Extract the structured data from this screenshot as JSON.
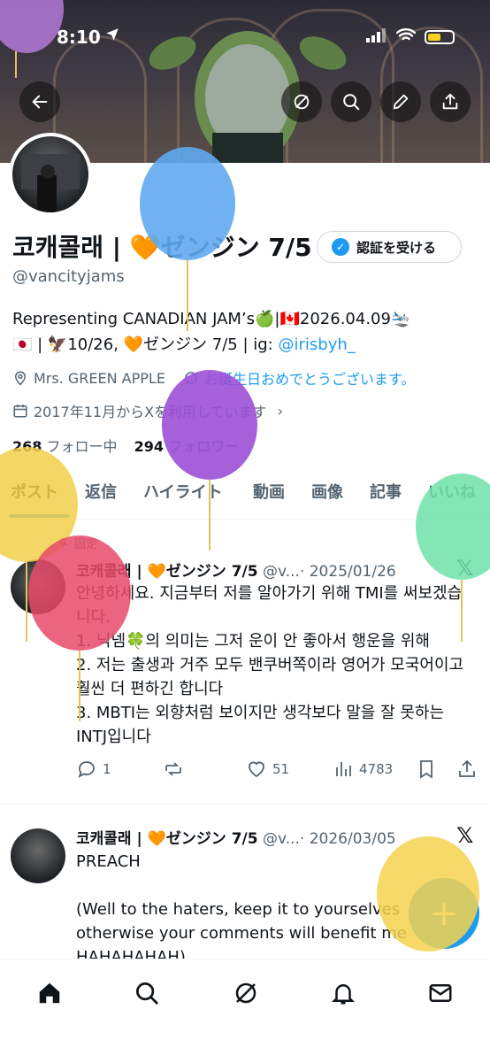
{
  "status_bar": {
    "time": "8:10"
  },
  "header_buttons": [
    "back-icon",
    "grok-icon",
    "search-icon",
    "edit-icon",
    "share-icon"
  ],
  "profile": {
    "display_name": "코캐콜래 | 🧡ゼンジン 7/5",
    "verify_button": "認証を受ける",
    "handle": "@vancityjams",
    "bio_line1": "Representing CANADIAN JAM’s🍏|🇨🇦2026.04.09🛬",
    "bio_line2_prefix": "🇯🇵 | 🦅10/26, 🧡ゼンジン 7/5 | ig: ",
    "bio_link": "@irisbyh_",
    "location": "Mrs. GREEN APPLE",
    "birthday": "お誕生日おめでとうございます。",
    "joined": "2017年11月からXを利用しています",
    "following_count": "268",
    "following_label": "フォロー中",
    "followers_count": "294",
    "followers_label": "フォロワー"
  },
  "tabs": [
    "ポスト",
    "返信",
    "ハイライト",
    "動画",
    "画像",
    "記事",
    "いいね"
  ],
  "posts": [
    {
      "pinned_label": "固定",
      "author": "코캐콜래 | 🧡ゼンジン 7/5",
      "handle": "@v...",
      "date": "· 2025/01/26",
      "text": "안녕하세요. 지금부터 저를 알아가기 위해 TMI를 써보겠습니다.\n1. 닉넴🍀의 의미는 그저 운이 안 좋아서 행운을 위해\n2. 저는 출생과 거주 모두 밴쿠버쪽이라 영어가 모국어이고 훨씬 더 편하긴 합니다\n3. MBTI는 외향처럼 보이지만 생각보다 말을 잘 못하는 INTJ입니다",
      "replies": "1",
      "likes": "51",
      "views": "4783"
    },
    {
      "author": "코캐콜래 | 🧡ゼンジン 7/5",
      "handle": "@v...",
      "date": "· 2026/03/05",
      "text": "PREACH\n\n(Well to the haters, keep it to yourselves otherwise your comments will benefit me HAHAHAHAH)"
    }
  ],
  "fab_label": "+",
  "bottom_nav": [
    "home-icon",
    "search-icon",
    "grok-icon",
    "notifications-icon",
    "messages-icon"
  ],
  "balloon_colors": [
    "#5fa8f0",
    "#9b4fd6",
    "#f2cf4a",
    "#e84a6a",
    "#6fe0a8",
    "#f4d24d",
    "#b57ad9"
  ]
}
